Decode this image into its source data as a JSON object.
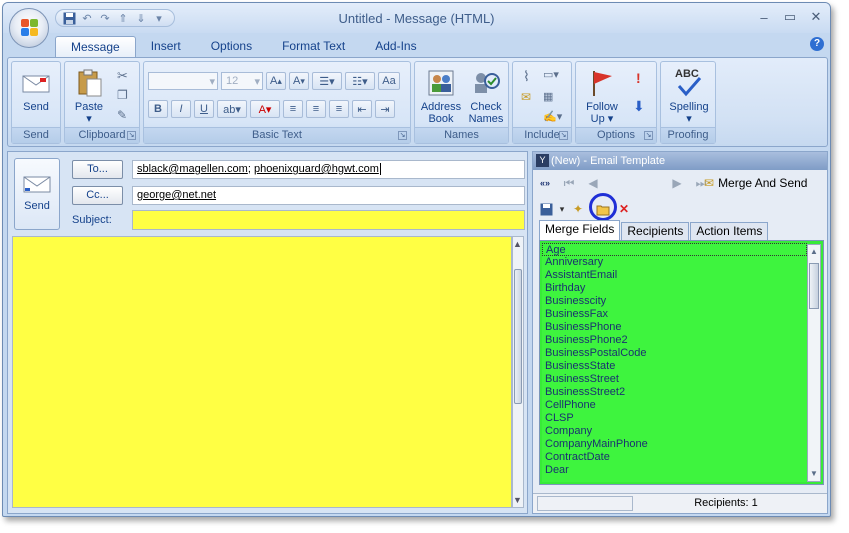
{
  "window": {
    "title": "Untitled - Message (HTML)",
    "controls": [
      "–",
      "▭",
      "✕"
    ]
  },
  "tabs": [
    "Message",
    "Insert",
    "Options",
    "Format Text",
    "Add-Ins"
  ],
  "ribbon": {
    "send": {
      "button": "Send",
      "group": "Send"
    },
    "clipboard": {
      "paste_line1": "Paste",
      "paste_arrow": "▾",
      "group": "Clipboard"
    },
    "basic_text": {
      "font_size": "12",
      "group": "Basic Text"
    },
    "names": {
      "address_book_1": "Address",
      "address_book_2": "Book",
      "check_names_1": "Check",
      "check_names_2": "Names",
      "group": "Names"
    },
    "include": {
      "group": "Include"
    },
    "options": {
      "follow_up_1": "Follow",
      "follow_up_2": "Up",
      "follow_up_arrow": "▾",
      "group": "Options"
    },
    "proofing": {
      "spelling_icon_text": "ABC",
      "spelling": "Spelling",
      "spelling_arrow": "▾",
      "group": "Proofing"
    }
  },
  "form": {
    "send_label": "Send",
    "to_button": "To...",
    "cc_button": "Cc...",
    "to_addr1": "sblack@magellen.com",
    "to_sep": "; ",
    "to_addr2": "phoenixguard@hgwt.com",
    "cc_value": "george@net.net",
    "subject_label": "Subject:",
    "subject_value": ""
  },
  "panel": {
    "title": "(New) - Email Template",
    "merge_and_send": "Merge And Send",
    "tabs": [
      "Merge Fields",
      "Recipients",
      "Action Items"
    ],
    "merge_fields": [
      "Age",
      "Anniversary",
      "AssistantEmail",
      "Birthday",
      "Businesscity",
      "BusinessFax",
      "BusinessPhone",
      "BusinessPhone2",
      "BusinessPostalCode",
      "BusinessState",
      "BusinessStreet",
      "BusinessStreet2",
      "CellPhone",
      "CLSP",
      "Company",
      "CompanyMainPhone",
      "ContractDate",
      "Dear"
    ],
    "status": "Recipients: 1"
  },
  "colors": {
    "subject_bg": "#ffff44",
    "body_bg": "#ffff44",
    "list_bg": "#3ef43e",
    "highlight_ring": "#1f2fd6"
  }
}
